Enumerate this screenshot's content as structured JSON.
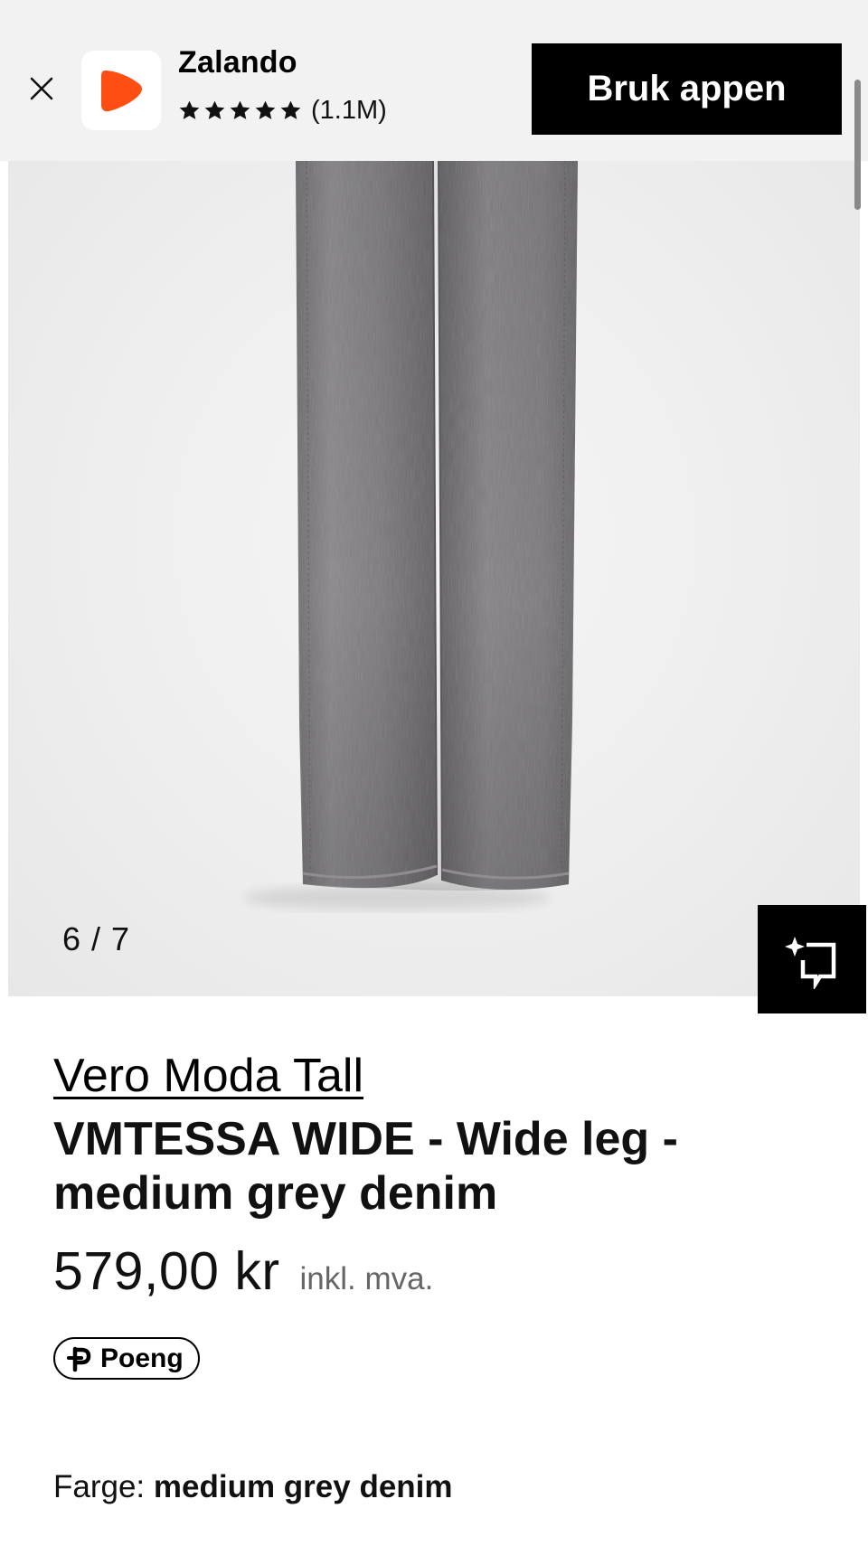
{
  "app_banner": {
    "app_name": "Zalando",
    "rating_count": "(1.1M)",
    "stars": 5,
    "open_app_label": "Bruk appen",
    "brand_color": "#ff4e14"
  },
  "gallery": {
    "counter": "6 / 7",
    "current_index": 6,
    "total_images": 7
  },
  "product": {
    "brand": "Vero Moda Tall",
    "name": "VMTESSA WIDE - Wide leg - medium grey denim",
    "price": "579,00 kr",
    "tax_note": "inkl. mva.",
    "points_label": "Poeng",
    "color_label": "Farge:",
    "color_value": "medium grey denim"
  },
  "icons": {
    "close": "close-icon",
    "app_logo": "zalando-logo",
    "star": "star-icon",
    "similar": "sparkle-frame-icon",
    "points": "points-p-icon"
  }
}
